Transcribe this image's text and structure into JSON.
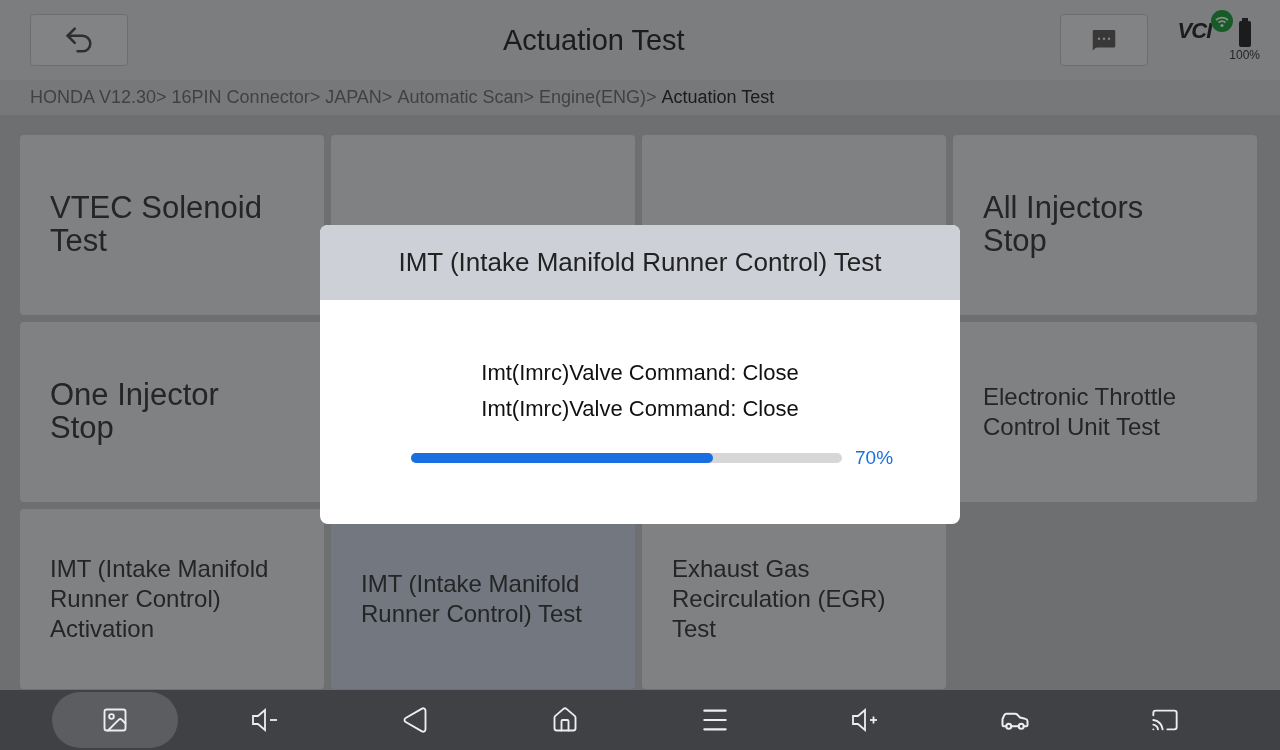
{
  "header": {
    "title": "Actuation Test",
    "vci_logo": "VCI",
    "battery_label": "100%"
  },
  "breadcrumb": [
    {
      "label": "HONDA V12.30>",
      "current": false
    },
    {
      "label": "16PIN Connector>",
      "current": false
    },
    {
      "label": "JAPAN>",
      "current": false
    },
    {
      "label": "Automatic Scan>",
      "current": false
    },
    {
      "label": "Engine(ENG)>",
      "current": false
    },
    {
      "label": "Actuation Test",
      "current": true
    }
  ],
  "tiles": [
    {
      "label": "VTEC Solenoid Test",
      "selected": false
    },
    {
      "selected": false
    },
    {
      "selected": false
    },
    {
      "label": "All Injectors Stop",
      "selected": false
    },
    {
      "label": "One Injector Stop",
      "selected": false
    },
    {
      "label": "Electronic Throttle Control Unit Test",
      "selected": false
    },
    {
      "label": "IMT (Intake Manifold Runner Control) Activation",
      "selected": false
    },
    {
      "label": "IMT (Intake Manifold Runner Control) Test",
      "selected": true
    },
    {
      "label": "Exhaust Gas Recirculation (EGR) Test",
      "selected": false
    }
  ],
  "dialog": {
    "title": "IMT (Intake Manifold Runner Control) Test",
    "lines": [
      "Imt(Imrc)Valve Command: Close",
      "Imt(Imrc)Valve Command: Close"
    ],
    "progress": {
      "level": 0.7,
      "reading": "70%"
    }
  },
  "nav_bar": [
    {
      "kind": "gallery",
      "selected": true
    },
    {
      "kind": "volume-down",
      "selected": false
    },
    {
      "kind": "back",
      "selected": false
    },
    {
      "kind": "home",
      "selected": false
    },
    {
      "kind": "menu",
      "selected": false
    },
    {
      "kind": "volume-up",
      "selected": false
    },
    {
      "kind": "car",
      "selected": false
    },
    {
      "kind": "screen",
      "selected": false
    }
  ]
}
